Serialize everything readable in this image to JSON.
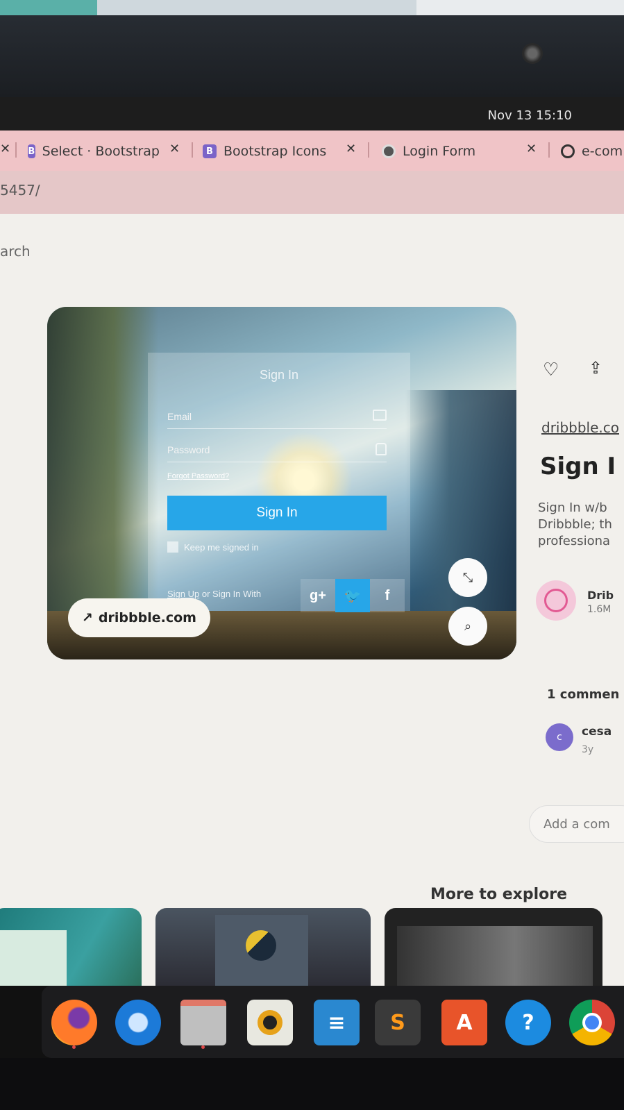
{
  "clock": {
    "date": "Nov 13",
    "time": "15:10"
  },
  "tabs": [
    {
      "label": "Select · Bootstrap",
      "icon": "bootstrap-icon"
    },
    {
      "label": "Bootstrap Icons",
      "icon": "bootstrap-icon"
    },
    {
      "label": "Login Form",
      "icon": "globe-icon"
    },
    {
      "label": "e-com",
      "icon": "github-icon"
    }
  ],
  "address": {
    "url": "5457/"
  },
  "page": {
    "search_partial": "arch",
    "shot": {
      "form_title": "Sign In",
      "email_label": "Email",
      "password_label": "Password",
      "forgot_label": "Forgot Password?",
      "signin_button": "Sign In",
      "keep_label": "Keep me signed in",
      "signup_label": "Sign Up",
      "or_label": "or Sign In With",
      "social": {
        "google": "g+",
        "twitter": "🐦",
        "facebook": "f"
      },
      "source_pill": "dribbble.com"
    },
    "side": {
      "source_link": "dribbble.co",
      "title": "Sign I",
      "description": [
        "Sign In w/b",
        "Dribbble; th",
        "professiona"
      ],
      "author_name": "Drib",
      "author_followers": "1.6M",
      "comments_heading": "1 commen",
      "comment_avatar_letter": "c",
      "comment_user": "cesa",
      "comment_time": "3y",
      "comment_placeholder": "Add a com"
    },
    "more_heading": "More to explore"
  },
  "dock": {
    "apps": [
      "firefox-icon",
      "thunderbird-icon",
      "files-icon",
      "rhythmbox-icon",
      "writer-icon",
      "sublime-icon",
      "software-store-icon",
      "help-icon",
      "chrome-icon"
    ],
    "sublime_glyph": "S",
    "store_glyph": "A",
    "help_glyph": "?"
  },
  "colors": {
    "accent": "#27a6e8",
    "tab_strip": "#f0c4c7",
    "page_bg": "#f2f0ec"
  }
}
